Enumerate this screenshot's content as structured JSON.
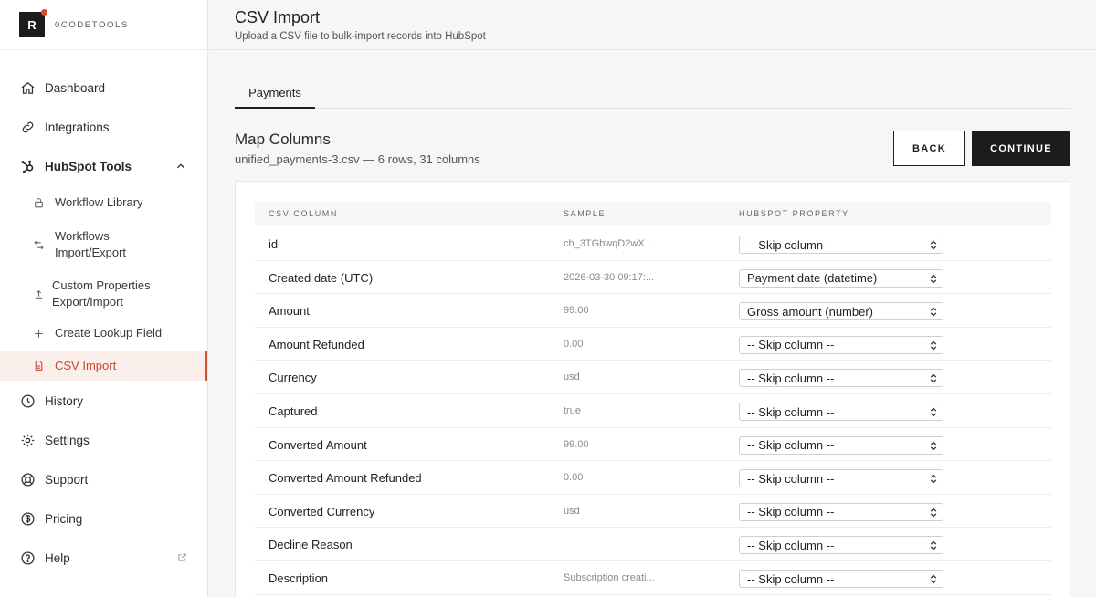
{
  "brand": {
    "logo_letter": "R",
    "name": "0CODETOOLS",
    "accent_color": "#e0482b"
  },
  "sidebar": {
    "items": [
      {
        "label": "Dashboard",
        "icon": "home-icon"
      },
      {
        "label": "Integrations",
        "icon": "link-icon"
      },
      {
        "label": "HubSpot Tools",
        "icon": "hubspot-icon",
        "expanded": true
      },
      {
        "label": "History",
        "icon": "clock-icon"
      },
      {
        "label": "Settings",
        "icon": "gear-icon"
      },
      {
        "label": "Support",
        "icon": "lifebuoy-icon"
      },
      {
        "label": "Pricing",
        "icon": "dollar-circle-icon"
      },
      {
        "label": "Help",
        "icon": "help-circle-icon"
      }
    ],
    "sub_items": [
      {
        "label": "Workflow Library",
        "icon": "lock-icon"
      },
      {
        "label": "Workflows Import/Export",
        "icon": "swap-arrows-icon"
      },
      {
        "label": "Custom Properties Export/Import",
        "icon": "upload-icon"
      },
      {
        "label": "Create Lookup Field",
        "icon": "plus-icon"
      },
      {
        "label": "CSV Import",
        "icon": "file-icon",
        "active": true
      }
    ]
  },
  "header": {
    "title": "CSV Import",
    "subtitle": "Upload a CSV file to bulk-import records into HubSpot"
  },
  "tabs": [
    {
      "label": "Payments",
      "active": true
    }
  ],
  "section": {
    "title": "Map Columns",
    "meta": "unified_payments-3.csv — 6 rows, 31 columns"
  },
  "buttons": {
    "back": "BACK",
    "continue": "CONTINUE"
  },
  "table": {
    "headers": {
      "csv_column": "CSV COLUMN",
      "sample": "SAMPLE",
      "hubspot_property": "HUBSPOT PROPERTY"
    },
    "rows": [
      {
        "column": "id",
        "sample": "ch_3TGbwqD2wX...",
        "property": "-- Skip column --"
      },
      {
        "column": "Created date (UTC)",
        "sample": "2026-03-30 09:17:...",
        "property": "Payment date (datetime)"
      },
      {
        "column": "Amount",
        "sample": "99.00",
        "property": "Gross amount (number)"
      },
      {
        "column": "Amount Refunded",
        "sample": "0.00",
        "property": "-- Skip column --"
      },
      {
        "column": "Currency",
        "sample": "usd",
        "property": "-- Skip column --"
      },
      {
        "column": "Captured",
        "sample": "true",
        "property": "-- Skip column --"
      },
      {
        "column": "Converted Amount",
        "sample": "99.00",
        "property": "-- Skip column --"
      },
      {
        "column": "Converted Amount Refunded",
        "sample": "0.00",
        "property": "-- Skip column --"
      },
      {
        "column": "Converted Currency",
        "sample": "usd",
        "property": "-- Skip column --"
      },
      {
        "column": "Decline Reason",
        "sample": "",
        "property": "-- Skip column --"
      },
      {
        "column": "Description",
        "sample": "Subscription creati...",
        "property": "-- Skip column --"
      }
    ]
  }
}
